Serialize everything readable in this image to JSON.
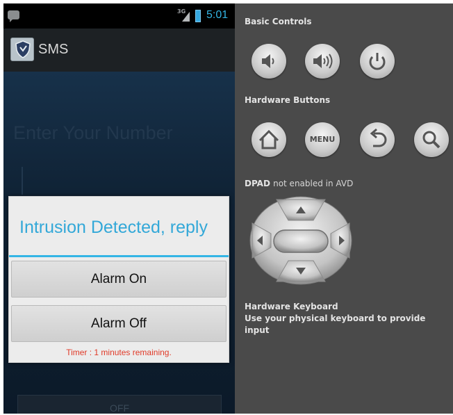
{
  "status_bar": {
    "network_type": "3G",
    "time": "5:01",
    "icons": [
      "sms-notification-icon",
      "signal-icon",
      "battery-icon"
    ]
  },
  "action_bar": {
    "title": "SMS",
    "icon": "shield-app-icon"
  },
  "content": {
    "number_hint": "Enter Your Number",
    "off_button_label": "OFF"
  },
  "dialog": {
    "title": "Intrusion Detected, reply",
    "buttons": [
      "Alarm On",
      "Alarm Off"
    ],
    "timer_text": "Timer : 1 minutes remaining."
  },
  "controls": {
    "basic_controls_label": "Basic Controls",
    "basic_buttons": [
      "volume-down-icon",
      "volume-up-icon",
      "power-icon"
    ],
    "hardware_buttons_label": "Hardware Buttons",
    "hardware_buttons": [
      "home-icon",
      "menu-button",
      "back-icon",
      "search-icon"
    ],
    "menu_label": "MENU",
    "dpad_label": "DPAD",
    "dpad_note": "not enabled in AVD",
    "keyboard_label": "Hardware Keyboard",
    "keyboard_note": "Use your physical keyboard to provide input"
  },
  "colors": {
    "accent": "#33b5e5",
    "timer_text": "#e03a28",
    "panel_background": "#4a4a4a",
    "app_background": "#0f2133"
  }
}
